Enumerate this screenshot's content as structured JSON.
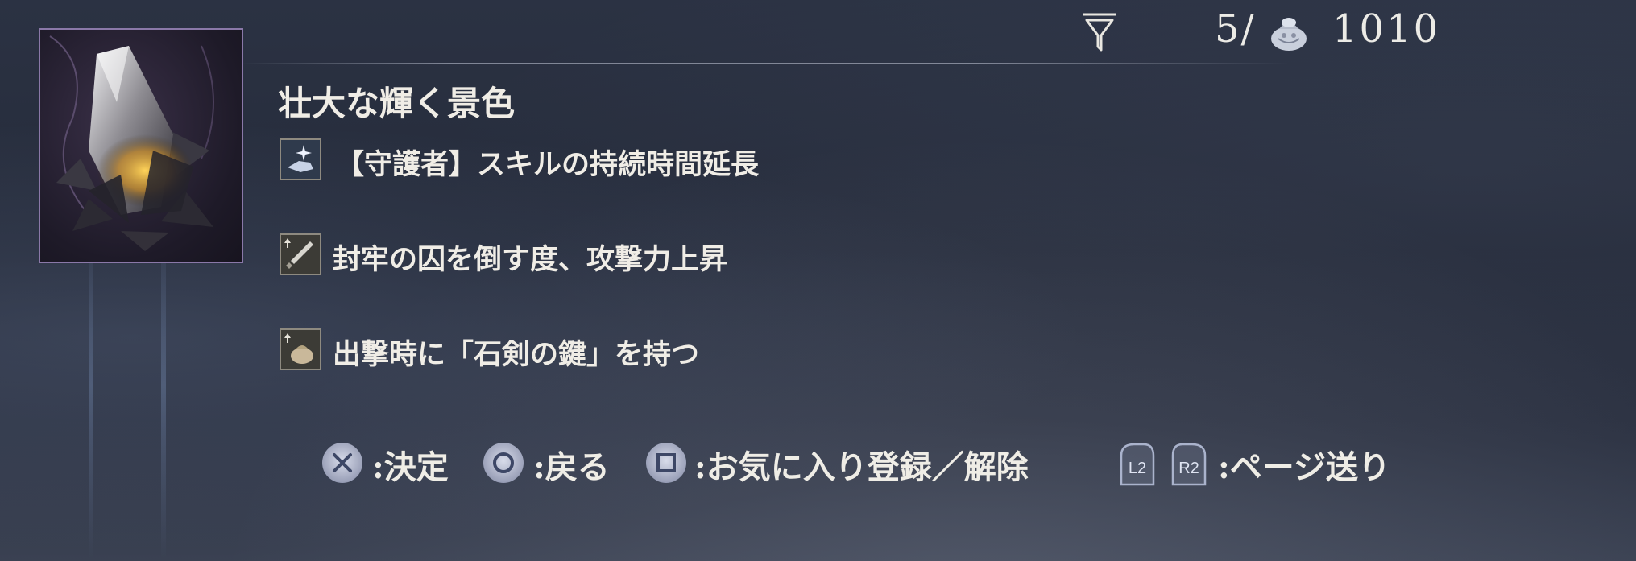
{
  "header": {
    "count_label": "5/",
    "currency_value": "1010",
    "filter_icon": "filter-funnel-icon",
    "currency_icon": "coin-pouch-icon"
  },
  "item": {
    "name": "壮大な輝く景色",
    "image": "crystal-relic-image",
    "effects": [
      {
        "text": "【守護者】スキルの持続時間延長",
        "icon": "skill-hand-icon"
      },
      {
        "text": "封牢の囚を倒す度、攻撃力上昇",
        "icon": "sword-up-icon"
      },
      {
        "text": "出撃時に「石剣の鍵」を持つ",
        "icon": "pouch-up-icon"
      }
    ]
  },
  "controls": {
    "confirm_label": ":決定",
    "back_label": ":戻る",
    "favorite_label": ":お気に入り登録／解除",
    "l2_label": "L2",
    "r2_label": "R2",
    "page_label": ":ページ送り",
    "colors": {
      "button_face": "#b9bed3",
      "symbol": "#3d4766"
    }
  }
}
